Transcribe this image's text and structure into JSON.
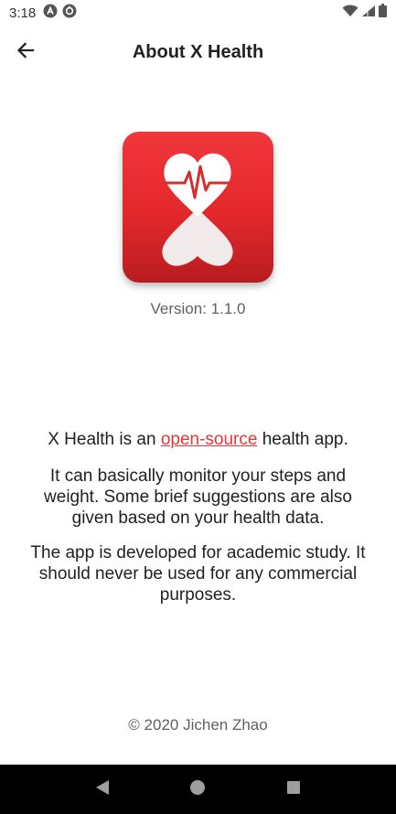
{
  "status_bar": {
    "time": "3:18",
    "left_icons": [
      "android-auto-icon",
      "sync-icon"
    ],
    "right_icons": [
      "wifi-icon",
      "signal-icon",
      "battery-icon"
    ]
  },
  "app_bar": {
    "back_icon": "arrow-left-icon",
    "title": "About X Health"
  },
  "logo": {
    "icon": "x-health-heart-logo",
    "colors": {
      "top": "#f0373b",
      "bottom": "#b81c20",
      "heart": "#ffffff",
      "pulse": "#d32f2f"
    }
  },
  "version": "Version: 1.1.0",
  "description": {
    "intro_prefix": "X Health is an ",
    "intro_link": "open-source",
    "intro_suffix": " health app.",
    "paragraph2": "It can basically monitor your steps and weight. Some brief suggestions are also given based on your health data.",
    "paragraph3": "The app is developed for academic study. It should never be used for any commercial purposes."
  },
  "footer": {
    "copyright": "© 2020 Jichen Zhao"
  },
  "nav_bar": {
    "buttons": [
      "back-triangle-icon",
      "home-circle-icon",
      "recents-square-icon"
    ]
  },
  "colors": {
    "accent": "#e53935",
    "text": "#212121",
    "muted": "#616161"
  }
}
